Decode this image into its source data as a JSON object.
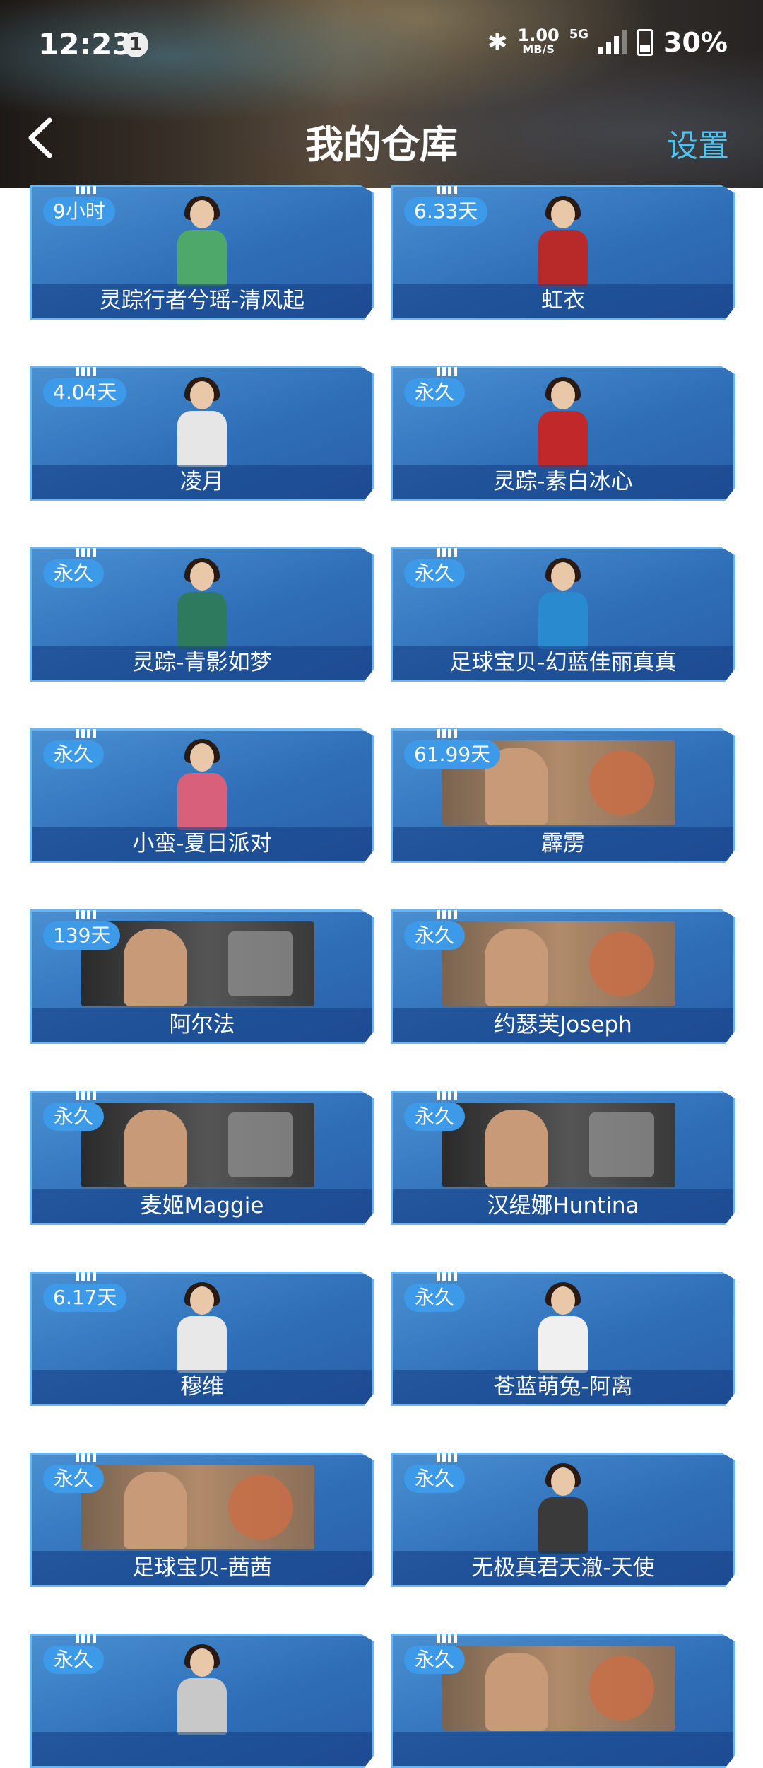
{
  "status_bar": {
    "time": "12:23",
    "notification_count": "1",
    "network_speed_value": "1.00",
    "network_speed_unit": "MB/S",
    "network_type": "5G",
    "battery": "30%"
  },
  "nav": {
    "title": "我的仓库",
    "settings_label": "设置",
    "back_icon": "chevron-left-icon"
  },
  "items": [
    {
      "badge": "9小时",
      "name": "灵踪行者兮瑶-清风起",
      "art": "figure",
      "body_color": "#4da86a"
    },
    {
      "badge": "6.33天",
      "name": "虹衣",
      "art": "figure",
      "body_color": "#b82a2a"
    },
    {
      "badge": "4.04天",
      "name": "凌月",
      "art": "figure",
      "body_color": "#e6e6e6"
    },
    {
      "badge": "永久",
      "name": "灵踪-素白冰心",
      "art": "figure",
      "body_color": "#c0282a"
    },
    {
      "badge": "永久",
      "name": "灵踪-青影如梦",
      "art": "figure",
      "body_color": "#2e7a5e"
    },
    {
      "badge": "永久",
      "name": "足球宝贝-幻蓝佳丽真真",
      "art": "figure",
      "body_color": "#2a8ad0"
    },
    {
      "badge": "永久",
      "name": "小蛮-夏日派对",
      "art": "figure",
      "body_color": "#d8607a"
    },
    {
      "badge": "61.99天",
      "name": "霹雳",
      "art": "wide-brown"
    },
    {
      "badge": "139天",
      "name": "阿尔法",
      "art": "wide-dark"
    },
    {
      "badge": "永久",
      "name": "约瑟芙Joseph",
      "art": "wide-brown"
    },
    {
      "badge": "永久",
      "name": "麦姬Maggie",
      "art": "wide-dark"
    },
    {
      "badge": "永久",
      "name": "汉缇娜Huntina",
      "art": "wide-dark-star"
    },
    {
      "badge": "6.17天",
      "name": "穆维",
      "art": "figure",
      "body_color": "#e8e8e8"
    },
    {
      "badge": "永久",
      "name": "苍蓝萌兔-阿离",
      "art": "figure",
      "body_color": "#f0f0f0"
    },
    {
      "badge": "永久",
      "name": "足球宝贝-茜茜",
      "art": "wide-brown"
    },
    {
      "badge": "永久",
      "name": "无极真君天澈-天使",
      "art": "figure",
      "body_color": "#3a3a3a"
    },
    {
      "badge": "永久",
      "name": "",
      "art": "figure",
      "body_color": "#c8c8c8"
    },
    {
      "badge": "永久",
      "name": "",
      "art": "wide-brown"
    }
  ]
}
